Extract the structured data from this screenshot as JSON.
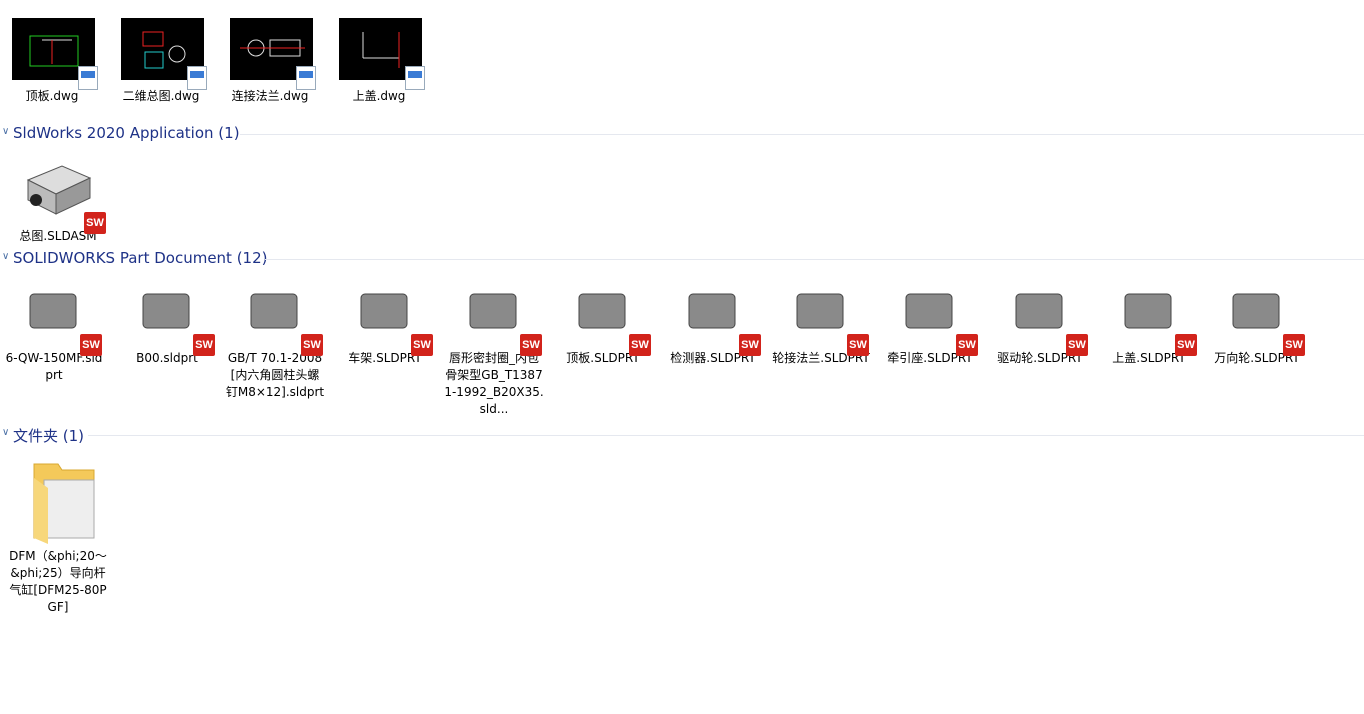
{
  "dwg_items": [
    {
      "label": "顶板.dwg",
      "icon": "dwg-file-icon"
    },
    {
      "label": "二维总图.dwg",
      "icon": "dwg-file-icon"
    },
    {
      "label": "连接法兰.dwg",
      "icon": "dwg-file-icon"
    },
    {
      "label": "上盖.dwg",
      "icon": "dwg-file-icon"
    }
  ],
  "groups": {
    "app": {
      "title": "SldWorks 2020 Application (1)"
    },
    "part": {
      "title": "SOLIDWORKS Part Document (12)"
    },
    "folder": {
      "title": "文件夹 (1)"
    }
  },
  "asm_items": [
    {
      "label": "总图.SLDASM",
      "badge": "SW",
      "badge_year": "2020"
    }
  ],
  "part_items": [
    {
      "label": "6-QW-150MF.sldprt"
    },
    {
      "label": "B00.sldprt"
    },
    {
      "label": "GB∕T 70.1-2008[内六角圆柱头螺钉M8×12].sldprt"
    },
    {
      "label": "车架.SLDPRT"
    },
    {
      "label": "唇形密封圈_内包骨架型GB_T13871-1992_B20X35.sld..."
    },
    {
      "label": "顶板.SLDPRT"
    },
    {
      "label": "检测器.SLDPRT"
    },
    {
      "label": "轮接法兰.SLDPRT"
    },
    {
      "label": "牵引座.SLDPRT"
    },
    {
      "label": "驱动轮.SLDPRT"
    },
    {
      "label": "上盖.SLDPRT"
    },
    {
      "label": "万向轮.SLDPRT"
    }
  ],
  "folder_items": [
    {
      "label": "DFM（&phi;20～&phi;25）导向杆气缸[DFM25-80PGF]",
      "icon": "folder-icon"
    }
  ],
  "badges": {
    "sw": "SW",
    "sw_color": "#d2231b",
    "dwg_color": "#3a7bd5"
  },
  "group_color": "#1e3287"
}
